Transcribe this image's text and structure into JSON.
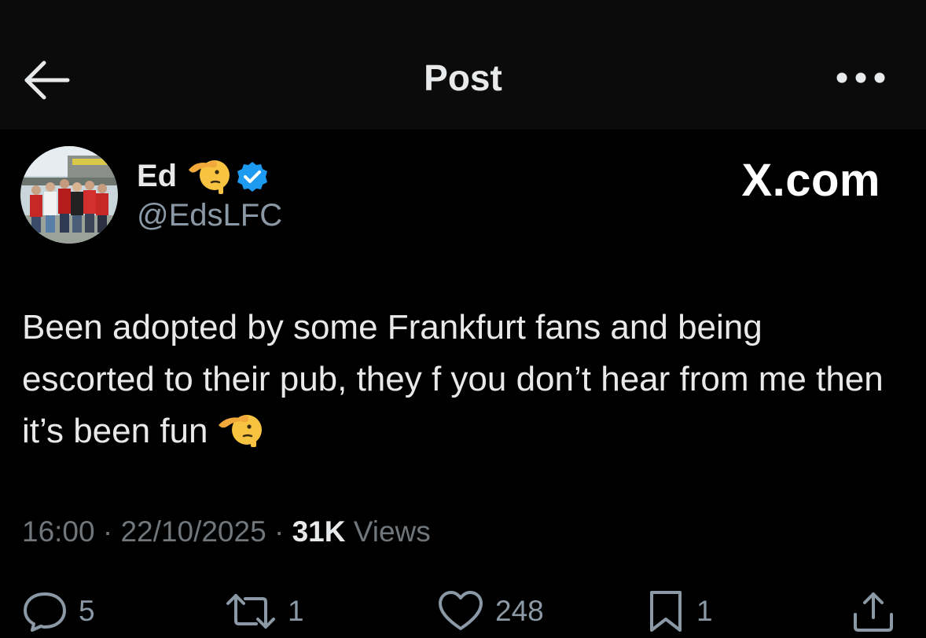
{
  "header": {
    "title": "Post",
    "back_icon": "arrow-left-icon",
    "more_icon": "more-horizontal-icon"
  },
  "author": {
    "display_name": "Ed",
    "name_emoji": "saluting-face",
    "verified": true,
    "handle": "@EdsLFC"
  },
  "watermark": "X.com",
  "post": {
    "text": "Been adopted by some Frankfurt fans and being escorted to their pub, they f you don’t hear from me then it’s been fun",
    "text_emoji": "saluting-face"
  },
  "meta": {
    "time": "16:00",
    "separator": "·",
    "date": "22/10/2025",
    "views_count": "31K",
    "views_label": "Views"
  },
  "actions": {
    "replies": "5",
    "reposts": "1",
    "likes": "248",
    "bookmarks": "1"
  },
  "colors": {
    "background": "#000000",
    "header_background": "#0b0b0b",
    "primary_text": "#e7e9ea",
    "secondary_text": "#71767b",
    "verified_blue": "#1d9bf0"
  }
}
